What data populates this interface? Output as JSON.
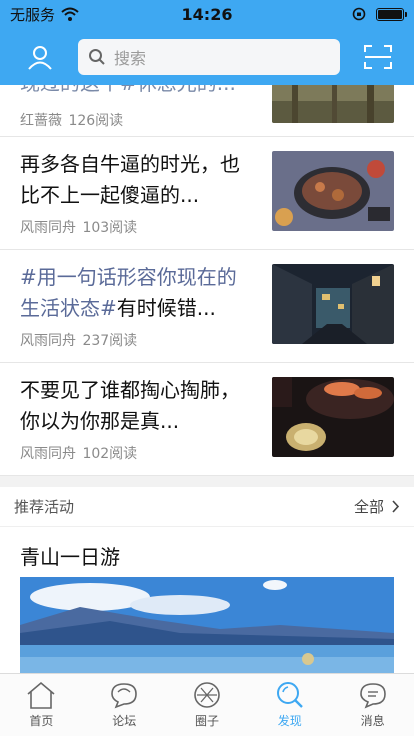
{
  "status_bar": {
    "carrier": "无服务",
    "time": "14:26"
  },
  "search": {
    "placeholder": "搜索"
  },
  "feed": [
    {
      "title_highlight": "",
      "title": "现过的这个#休息光的...",
      "author": "红蔷薇",
      "reads": "126阅读"
    },
    {
      "title_highlight": "",
      "title": "再多各自牛逼的时光，也比不上一起傻逼的...",
      "author": "风雨同舟",
      "reads": "103阅读"
    },
    {
      "title_highlight": "#用一句话形容你现在的生活状态#",
      "title": "有时候错...",
      "author": "风雨同舟",
      "reads": "237阅读"
    },
    {
      "title_highlight": "",
      "title": "不要见了谁都掏心掏肺，你以为你那是真...",
      "author": "风雨同舟",
      "reads": "102阅读"
    }
  ],
  "recommend": {
    "title": "推荐活动",
    "all_label": "全部",
    "activity_name": "青山一日游"
  },
  "tabs": [
    {
      "label": "首页",
      "icon": "home-icon"
    },
    {
      "label": "论坛",
      "icon": "forum-icon"
    },
    {
      "label": "圈子",
      "icon": "circle-icon"
    },
    {
      "label": "发现",
      "icon": "discover-icon",
      "active": true
    },
    {
      "label": "消息",
      "icon": "message-icon"
    }
  ],
  "colors": {
    "brand": "#3ea8f2",
    "highlight": "#5a6a98"
  }
}
